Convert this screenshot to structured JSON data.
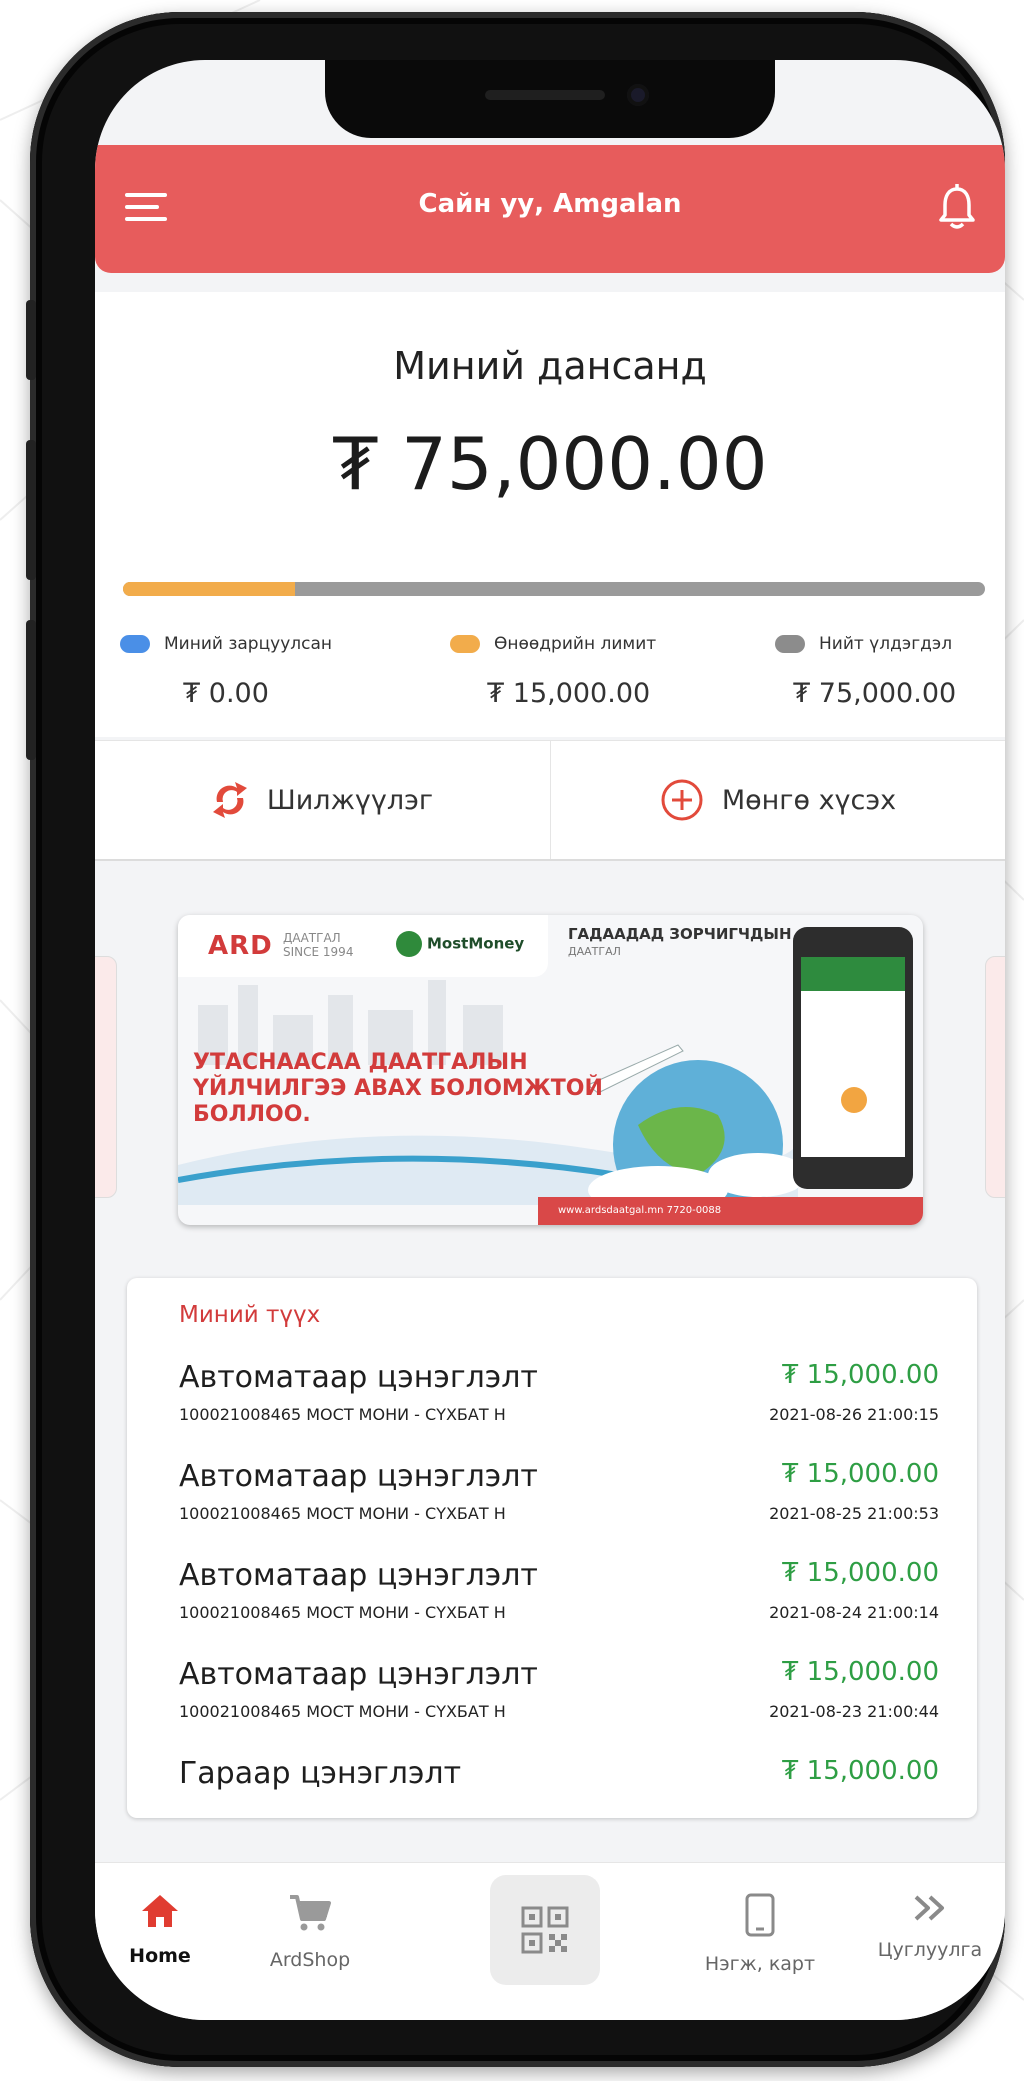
{
  "header": {
    "title": "Сайн уу, Amgalan"
  },
  "balance": {
    "label": "Миний дансанд",
    "amount": "₮ 75,000.00",
    "progress_fraction": 0.2
  },
  "legend": [
    {
      "label": "Миний зарцуулсан",
      "value": "₮ 0.00",
      "color": "#4a8fe7"
    },
    {
      "label": "Өнөөдрийн лимит",
      "value": "₮ 15,000.00",
      "color": "#f2ac4b"
    },
    {
      "label": "Нийт үлдэгдэл",
      "value": "₮ 75,000.00",
      "color": "#8c8c8c"
    }
  ],
  "actions": {
    "transfer": "Шилжүүлэг",
    "request": "Мөнгө хүсэх"
  },
  "banner": {
    "ard_logo": "ARD",
    "ard_sub_1": "ДААТГАЛ",
    "ard_sub_2": "SINCE 1994",
    "mostmoney": "MostMoney",
    "title_right": "ГАДААДАД ЗОРЧИГЧДЫН",
    "title_right_sub": "ДААТГАЛ",
    "headline_1": "УТАСНААСАА ДААТГАЛЫН",
    "headline_2": "ҮЙЛЧИЛГЭЭ АВАХ БОЛОМЖТОЙ",
    "headline_3": "БОЛЛОО.",
    "footer": "www.ardsdaatgal.mn     7720-0088"
  },
  "history": {
    "title": "Миний түүх",
    "items": [
      {
        "title": "Автоматаар цэнэглэлт",
        "sub": "100021008465 МОСТ МОНИ - СҮХБАТ Н",
        "amount": "₮ 15,000.00",
        "date": "2021-08-26 21:00:15"
      },
      {
        "title": "Автоматаар цэнэглэлт",
        "sub": "100021008465 МОСТ МОНИ - СҮХБАТ Н",
        "amount": "₮ 15,000.00",
        "date": "2021-08-25 21:00:53"
      },
      {
        "title": "Автоматаар цэнэглэлт",
        "sub": "100021008465 МОСТ МОНИ - СҮХБАТ Н",
        "amount": "₮ 15,000.00",
        "date": "2021-08-24 21:00:14"
      },
      {
        "title": "Автоматаар цэнэглэлт",
        "sub": "100021008465 МОСТ МОНИ - СҮХБАТ Н",
        "amount": "₮ 15,000.00",
        "date": "2021-08-23 21:00:44"
      },
      {
        "title": "Гараар цэнэглэлт",
        "sub": "",
        "amount": "₮ 15,000.00",
        "date": ""
      }
    ]
  },
  "nav": {
    "home": "Home",
    "shop": "ArdShop",
    "cards": "Нэгж, карт",
    "collections": "Цуглуулга"
  },
  "colors": {
    "header": "#e75c5c",
    "accent_red": "#d23b3b",
    "amount_green": "#2e9e44",
    "progress_orange": "#f2ac4b",
    "progress_gray": "#9a9a9a"
  }
}
